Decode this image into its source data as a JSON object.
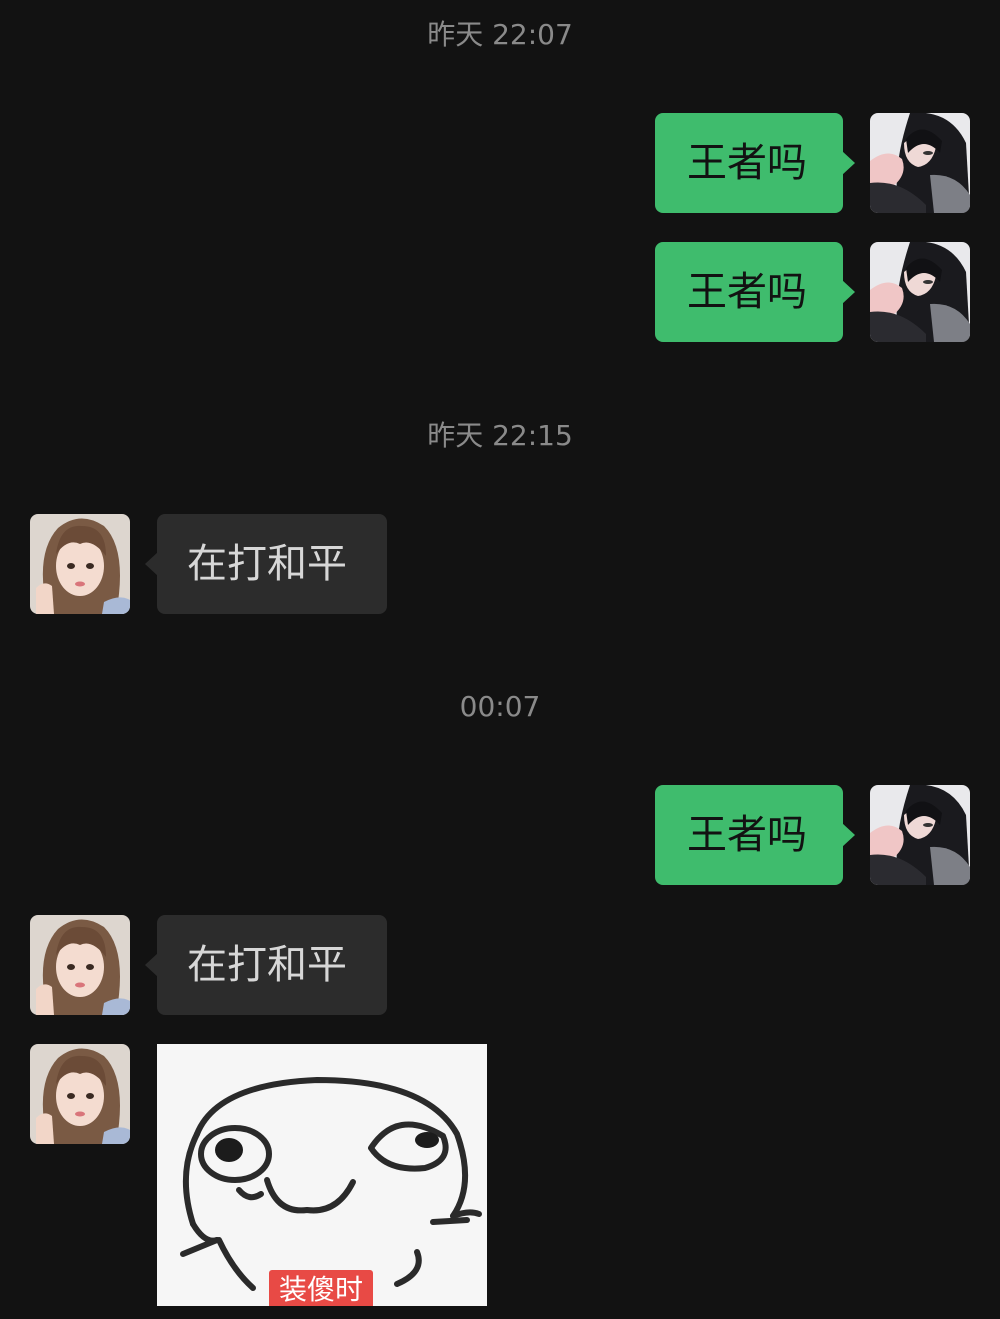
{
  "chat": {
    "messages": [
      {
        "type": "time",
        "text": "昨天 22:07"
      },
      {
        "type": "text",
        "direction": "out",
        "sender": "me",
        "text": "王者吗"
      },
      {
        "type": "text",
        "direction": "out",
        "sender": "me",
        "text": "王者吗"
      },
      {
        "type": "time",
        "text": "昨天 22:15"
      },
      {
        "type": "text",
        "direction": "in",
        "sender": "contact",
        "text": "在打和平"
      },
      {
        "type": "time",
        "text": "00:07"
      },
      {
        "type": "text",
        "direction": "out",
        "sender": "me",
        "text": "王者吗"
      },
      {
        "type": "text",
        "direction": "in",
        "sender": "contact",
        "text": "在打和平"
      },
      {
        "type": "sticker",
        "direction": "in",
        "sender": "contact",
        "caption": "装傻时",
        "icon": "silly-face-sticker"
      }
    ]
  },
  "colors": {
    "background": "#121212",
    "outgoing_bubble": "#3fbc6d",
    "incoming_bubble": "#2c2c2c",
    "timestamp": "#8a8a8a"
  }
}
